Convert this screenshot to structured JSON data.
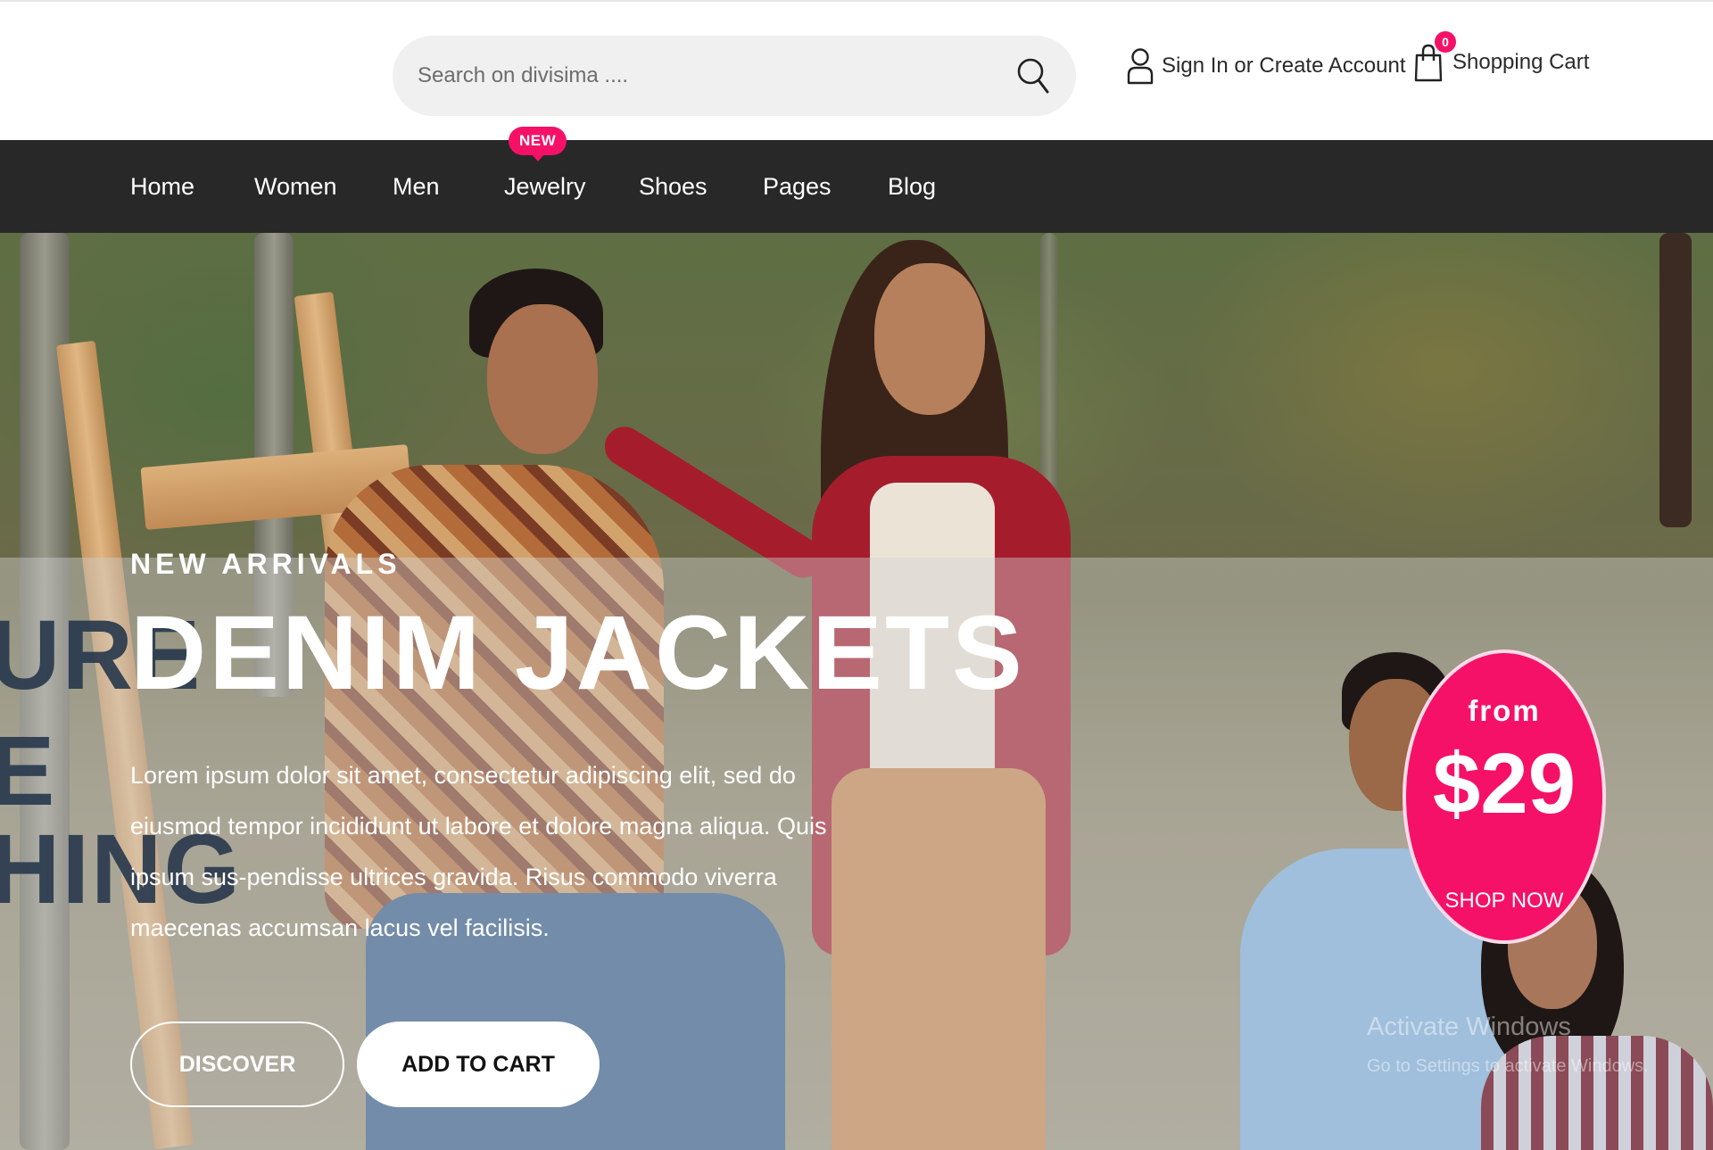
{
  "header": {
    "search": {
      "placeholder": "Search on divisima ...."
    },
    "account_label": "Sign In or Create Account",
    "cart": {
      "count": "0",
      "label": "Shopping Cart"
    }
  },
  "nav": {
    "items": [
      {
        "label": "Home"
      },
      {
        "label": "Women"
      },
      {
        "label": "Men"
      },
      {
        "label": "Jewelry",
        "badge": "NEW"
      },
      {
        "label": "Shoes"
      },
      {
        "label": "Pages"
      },
      {
        "label": "Blog"
      }
    ]
  },
  "hero": {
    "kicker": "NEW ARRIVALS",
    "title": "DENIM JACKETS",
    "description": "Lorem ipsum dolor sit amet, consectetur adipiscing elit, sed do eiusmod tempor incididunt ut labore et dolore magna aliqua. Quis ipsum sus-pendisse ultrices gravida. Risus commodo viverra maecenas accumsan lacus vel facilisis.",
    "buttons": {
      "discover": "DISCOVER",
      "add_to_cart": "ADD TO CART"
    },
    "behind_text": [
      "URE",
      "E",
      "HING"
    ],
    "promo": {
      "from": "from",
      "price": "$29",
      "cta": "SHOP NOW"
    },
    "watermark": {
      "line1": "Activate Windows",
      "line2": "Go to Settings to activate Windows."
    }
  },
  "colors": {
    "accent": "#f51167",
    "nav_bg": "#282828",
    "search_bg": "#f0f0f0",
    "text_dark": "#2a2a2a"
  },
  "icons": {
    "search": "search-icon",
    "account": "user-icon",
    "cart": "shopping-bag-icon"
  }
}
